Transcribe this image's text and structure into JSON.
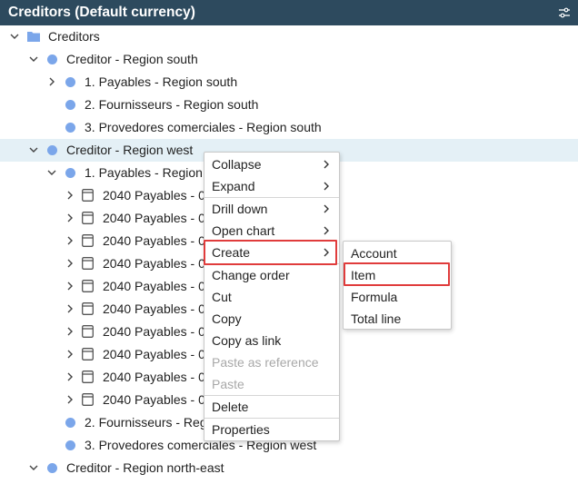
{
  "header": {
    "title": "Creditors (Default currency)",
    "settings_icon": "sliders-icon"
  },
  "tree": {
    "root": "Creditors",
    "region_south": "Creditor - Region south",
    "south_children": [
      "1. Payables - Region south",
      "2. Fournisseurs - Region south",
      "3. Provedores comerciales - Region south"
    ],
    "region_west": "Creditor - Region west",
    "west_payables": "1. Payables - Region w",
    "payables_items": [
      "2040 Payables - 0",
      "2040 Payables - 0",
      "2040 Payables - 0",
      "2040 Payables - 0",
      "2040 Payables - 0",
      "2040 Payables - 0",
      "2040 Payables - 0",
      "2040 Payables - 0",
      "2040 Payables - 0",
      "2040 Payables - 0"
    ],
    "west_fournisseurs": "2. Fournisseurs - Reg",
    "west_provedores": "3. Provedores comerciales - Region west",
    "region_north_east": "Creditor - Region north-east"
  },
  "context_menu": {
    "items": [
      "Collapse",
      "Expand",
      "Drill down",
      "Open chart",
      "Create",
      "Change order",
      "Cut",
      "Copy",
      "Copy as link",
      "Paste as reference",
      "Paste",
      "Delete",
      "Properties"
    ]
  },
  "submenu": {
    "items": [
      "Account",
      "Item",
      "Formula",
      "Total line"
    ]
  },
  "colors": {
    "header_bg": "#2d4a5e",
    "dot": "#7ba6ea",
    "selected_row": "#e4f0f6",
    "highlight": "#e03c3c"
  }
}
